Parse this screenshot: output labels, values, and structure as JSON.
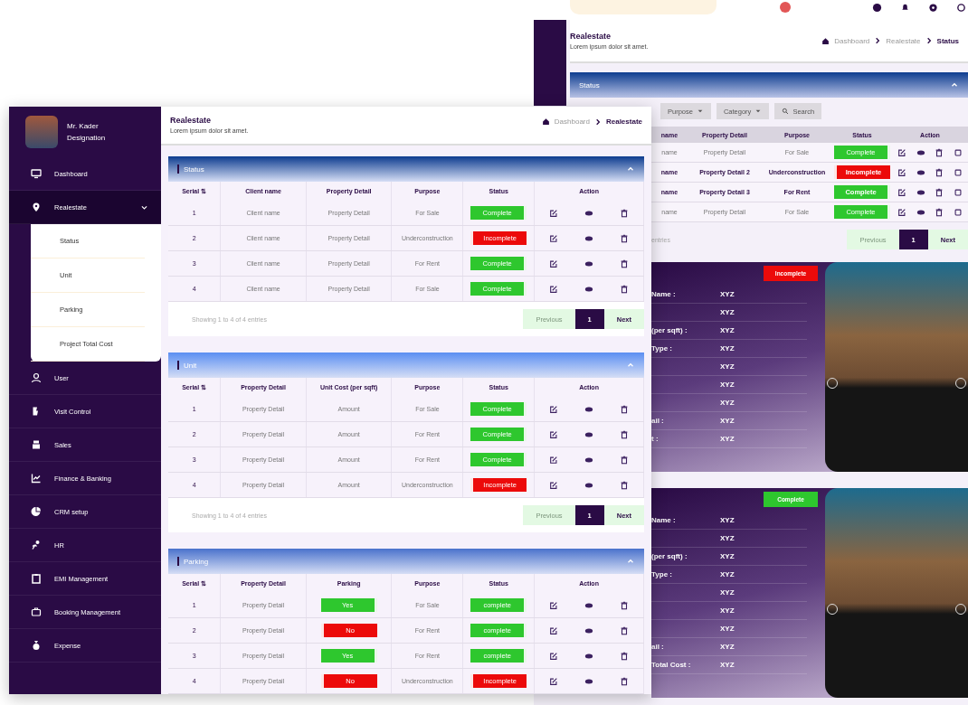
{
  "back_screen": {
    "header": {
      "title": "Realestate",
      "subtitle": "Lorem ipsum dolor sit amet.",
      "breadcrumb": [
        "Dashboard",
        "Realestate",
        "Status"
      ]
    },
    "panel": {
      "title": "Status",
      "color": "#0d3c8f"
    },
    "filters": [
      {
        "label": "Purpose",
        "kind": "dropdown"
      },
      {
        "label": "Category",
        "kind": "dropdown"
      },
      {
        "label": "Search",
        "kind": "search"
      }
    ],
    "table": {
      "columns": [
        "name",
        "Property Detail",
        "Purpose",
        "Status",
        "Action"
      ],
      "rows": [
        {
          "bold": false,
          "cells": [
            "name",
            "Property Detail",
            "For Sale",
            {
              "label": "Complete",
              "kind": "positive"
            }
          ]
        },
        {
          "bold": true,
          "cells": [
            "name",
            "Property Detail 2",
            "Underconstruction",
            {
              "label": "Incomplete",
              "kind": "negative"
            }
          ]
        },
        {
          "bold": true,
          "cells": [
            "name",
            "Property Detail 3",
            "For Rent",
            {
              "label": "Complete",
              "kind": "positive"
            }
          ]
        },
        {
          "bold": false,
          "cells": [
            "name",
            "Property Detail",
            "For Sale",
            {
              "label": "Complete",
              "kind": "positive"
            }
          ]
        }
      ]
    },
    "pagination": {
      "info": "entries",
      "previous": "Previous",
      "pages": [
        {
          "label": "1",
          "selected": true
        }
      ],
      "next": "Next"
    },
    "cards": [
      {
        "badge": {
          "label": "Incomplete",
          "kind": "negative"
        },
        "rows": [
          {
            "label": "Name :",
            "value": "XYZ"
          },
          {
            "value": "XYZ"
          },
          {
            "label": "(per sqft) :",
            "value": "XYZ"
          },
          {
            "label": "Type :",
            "value": "XYZ"
          },
          {
            "value": "XYZ"
          },
          {
            "value": "XYZ"
          },
          {
            "value": "XYZ"
          },
          {
            "label": "ail :",
            "value": "XYZ"
          },
          {
            "label": "t :",
            "value": "XYZ"
          }
        ]
      },
      {
        "badge": {
          "label": "Complete",
          "kind": "positive"
        },
        "rows": [
          {
            "label": "Name :",
            "value": "XYZ"
          },
          {
            "value": "XYZ"
          },
          {
            "label": "(per sqft) :",
            "value": "XYZ"
          },
          {
            "label": "Type :",
            "value": "XYZ"
          },
          {
            "value": "XYZ"
          },
          {
            "value": "XYZ"
          },
          {
            "value": "XYZ"
          },
          {
            "label": "ail :",
            "value": "XYZ"
          },
          {
            "label": "Total Cost :",
            "value": "XYZ"
          }
        ]
      }
    ]
  },
  "front_screen": {
    "profile": {
      "name": "Mr. Kader",
      "designation": "Designation"
    },
    "nav": [
      {
        "label": "Dashboard",
        "selected": false
      },
      {
        "label": "Realestate",
        "selected": true,
        "expanded": true,
        "children": [
          {
            "label": "Status"
          },
          {
            "label": "Unit"
          },
          {
            "label": "Parking"
          },
          {
            "label": "Project Total Cost"
          }
        ]
      },
      {
        "label": "User",
        "selected": false
      },
      {
        "label": "Visit Control",
        "selected": false
      },
      {
        "label": "Sales",
        "selected": false
      },
      {
        "label": "Finance & Banking",
        "selected": false
      },
      {
        "label": "CRM setup",
        "selected": false
      },
      {
        "label": "HR",
        "selected": false
      },
      {
        "label": "EMI Management",
        "selected": false
      },
      {
        "label": "Booking Management",
        "selected": false
      },
      {
        "label": "Expense",
        "selected": false
      }
    ],
    "header": {
      "title": "Realestate",
      "subtitle": "Lorem ipsum dolor sit amet.",
      "breadcrumb": [
        "Dashboard",
        "Realestate"
      ]
    },
    "panels": [
      {
        "title": "Status",
        "color": "#0d3c8f",
        "columns": [
          "Serial ⇅",
          "Client name",
          "Property Detail",
          "Purpose",
          "Status",
          "Action"
        ],
        "rows": [
          [
            "1",
            "Client name",
            "Property Detail",
            "For Sale",
            {
              "label": "Complete",
              "kind": "positive"
            }
          ],
          [
            "2",
            "Client name",
            "Property Detail",
            "Underconstruction",
            {
              "label": "Incomplete",
              "kind": "negative"
            }
          ],
          [
            "3",
            "Client name",
            "Property Detail",
            "For Rent",
            {
              "label": "Complete",
              "kind": "positive"
            }
          ],
          [
            "4",
            "Client name",
            "Property Detail",
            "For Sale",
            {
              "label": "Complete",
              "kind": "positive"
            }
          ]
        ],
        "footer": {
          "info": "Showing 1 to 4 of 4 entries",
          "previous": "Previous",
          "pages": [
            {
              "label": "1",
              "selected": true
            }
          ],
          "next": "Next"
        }
      },
      {
        "title": "Unit",
        "color": "#5b8ff2",
        "columns": [
          "Serial ⇅",
          "Property Detail",
          "Unit Cost (per sqft)",
          "Purpose",
          "Status",
          "Action"
        ],
        "rows": [
          [
            "1",
            "Property Detail",
            "Amount",
            "For Sale",
            {
              "label": "Complete",
              "kind": "positive"
            }
          ],
          [
            "2",
            "Property Detail",
            "Amount",
            "For Rent",
            {
              "label": "Complete",
              "kind": "positive"
            }
          ],
          [
            "3",
            "Property Detail",
            "Amount",
            "For Rent",
            {
              "label": "Complete",
              "kind": "positive"
            }
          ],
          [
            "4",
            "Property Detail",
            "Amount",
            "Underconstruction",
            {
              "label": "Incomplete",
              "kind": "negative"
            }
          ]
        ],
        "footer": {
          "info": "Showing 1 to 4 of 4 entries",
          "previous": "Previous",
          "pages": [
            {
              "label": "1",
              "selected": true
            }
          ],
          "next": "Next"
        }
      },
      {
        "title": "Parking",
        "color": "#4a72cc",
        "columns": [
          "Serial ⇅",
          "Property Detail",
          "Parking",
          "Purpose",
          "Status",
          "Action"
        ],
        "rows": [
          [
            "1",
            "Property Detail",
            {
              "label": "Yes",
              "kind": "positive"
            },
            "For Sale",
            {
              "label": "complete",
              "kind": "positive"
            }
          ],
          [
            "2",
            "Property Detail",
            {
              "label": "No",
              "kind": "negative"
            },
            "For Rent",
            {
              "label": "complete",
              "kind": "positive"
            }
          ],
          [
            "3",
            "Property Detail",
            {
              "label": "Yes",
              "kind": "positive"
            },
            "For Rent",
            {
              "label": "complete",
              "kind": "positive"
            }
          ],
          [
            "4",
            "Property Detail",
            {
              "label": "No",
              "kind": "negative"
            },
            "Underconstruction",
            {
              "label": "Incomplete",
              "kind": "negative"
            }
          ]
        ]
      }
    ]
  }
}
